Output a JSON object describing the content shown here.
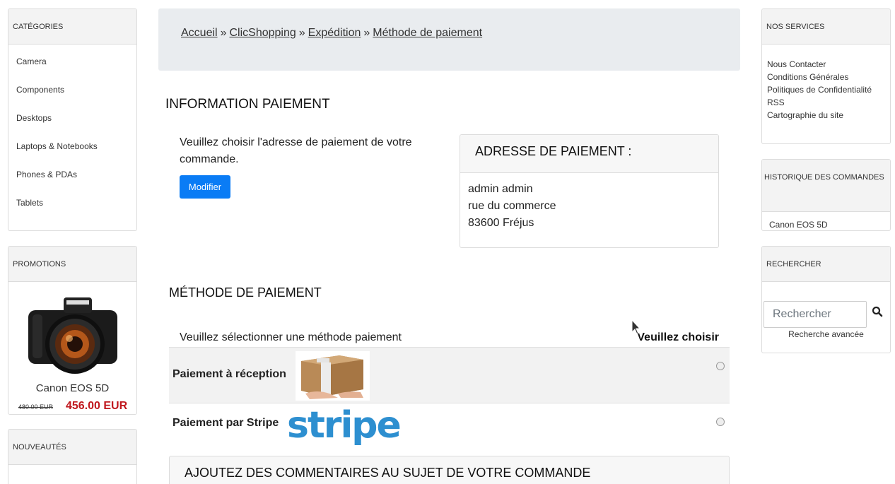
{
  "left": {
    "categories": {
      "title": "CATÉGORIES",
      "items": [
        "Camera",
        "Components",
        "Desktops",
        "Laptops & Notebooks",
        "Phones & PDAs",
        "Tablets"
      ]
    },
    "promotions": {
      "title": "PROMOTIONS",
      "product": "Canon EOS 5D",
      "old_price": "480.00 EUR",
      "new_price": "456.00 EUR"
    },
    "news": {
      "title": "NOUVEAUTÉS"
    }
  },
  "breadcrumb": {
    "items": [
      "Accueil",
      "ClicShopping",
      "Expédition",
      "Méthode de paiement"
    ],
    "separator": "»"
  },
  "info": {
    "title": "INFORMATION PAIEMENT",
    "intro": "Veuillez choisir l'adresse de paiement de votre commande.",
    "modify_button": "Modifier",
    "address_title": "ADRESSE DE PAIEMENT :",
    "address_lines": [
      "admin admin",
      "rue du commerce",
      "83600 Fréjus"
    ]
  },
  "method": {
    "title": "MÉTHODE DE PAIEMENT",
    "intro": "Veuillez sélectionner une méthode paiement",
    "choose": "Veuillez choisir",
    "options": [
      {
        "label": "Paiement à réception",
        "icon": "package-icon"
      },
      {
        "label": "Paiement par Stripe",
        "logo": "stripe"
      }
    ]
  },
  "comments": {
    "title": "AJOUTEZ DES COMMENTAIRES AU SUJET DE VOTRE COMMANDE"
  },
  "right": {
    "services": {
      "title": "NOS SERVICES",
      "items": [
        "Nous Contacter",
        "Conditions Générales",
        "Politiques de Confidentialité",
        "RSS",
        "Cartographie du site"
      ]
    },
    "history": {
      "title": "HISTORIQUE DES COMMANDES",
      "items": [
        "Canon EOS 5D"
      ]
    },
    "search": {
      "title": "RECHERCHER",
      "placeholder": "Rechercher",
      "advanced": "Recherche avancée"
    }
  },
  "colors": {
    "primary_button": "#0a7cf5",
    "price": "#c0181e",
    "stripe": "#2d8fd0"
  }
}
